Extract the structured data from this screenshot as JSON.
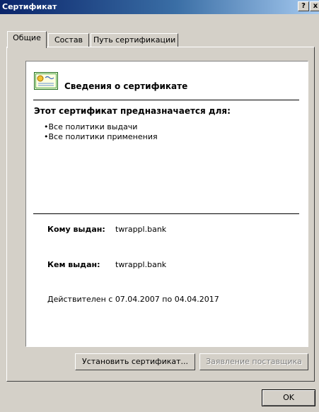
{
  "window": {
    "title": "Сертификат",
    "help_glyph": "?",
    "close_glyph": "x"
  },
  "tabs": [
    {
      "label": "Общие"
    },
    {
      "label": "Состав"
    },
    {
      "label": "Путь сертификации"
    }
  ],
  "info": {
    "heading": "Сведения о сертификате",
    "purpose_label": "Этот сертификат предназначается для:",
    "purposes": [
      "•Все политики выдачи",
      "•Все политики применения"
    ],
    "issued_to_label": "Кому выдан:",
    "issued_to_value": "twrappl.bank",
    "issued_by_label": "Кем выдан:",
    "issued_by_value": "twrappl.bank",
    "valid_from_label": "Действителен с",
    "valid_from": "07.04.2007",
    "valid_to_label": "по",
    "valid_to": "04.04.2017"
  },
  "buttons": {
    "install": "Установить сертификат...",
    "issuer_statement": "Заявление поставщика",
    "ok": "OK"
  },
  "icons": {
    "certificate": "certificate-icon"
  },
  "colors": {
    "face": "#d4d0c8",
    "title_start": "#0a246a",
    "title_end": "#a6caf0",
    "disabled_text": "#808080"
  }
}
